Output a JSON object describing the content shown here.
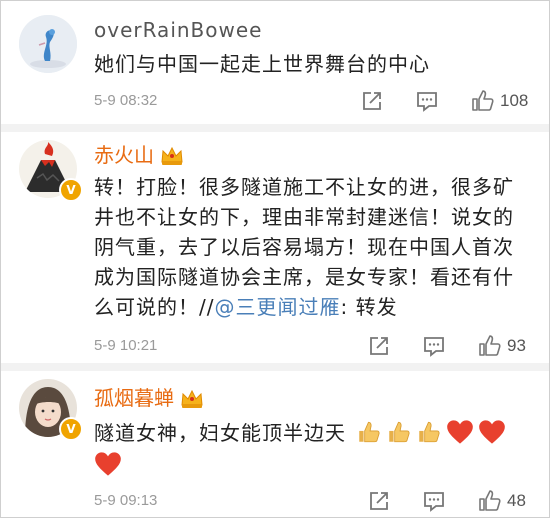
{
  "comments": [
    {
      "username": "overRainBowee",
      "text": "她们与中国一起走上世界舞台的中心",
      "time": "5-9 08:32",
      "like_count": "108",
      "verified": false,
      "vip_crown": false
    },
    {
      "username": "赤火山",
      "text_parts": {
        "before": "转！打脸！很多隧道施工不让女的进，很多矿井也不让女的下，理由非常封建迷信！说女的阴气重，去了以后容易塌方！现在中国人首次成为国际隧道协会主席，是女专家！看还有什么可说的！//",
        "mention": "@三更闻过雁",
        "after": ": 转发"
      },
      "time": "5-9 10:21",
      "like_count": "93",
      "verified": true,
      "vip_crown": true
    },
    {
      "username": "孤烟暮蝉",
      "text": "隧道女神，妇女能顶半边天",
      "emojis": [
        "thumbs-up",
        "thumbs-up",
        "thumbs-up",
        "heart",
        "heart",
        "heart"
      ],
      "time": "5-9 09:13",
      "like_count": "48",
      "verified": true,
      "vip_crown": true
    }
  ],
  "colors": {
    "username_gray": "#555555",
    "username_orange": "#e86b12",
    "mention_blue": "#4a7fb8",
    "meta_gray": "#9a9a9a",
    "verified_badge": "#f0a400"
  },
  "icons": {
    "share": "share-icon",
    "comment": "comment-icon",
    "like": "thumbs-up-icon",
    "crown": "vip-crown-icon"
  }
}
